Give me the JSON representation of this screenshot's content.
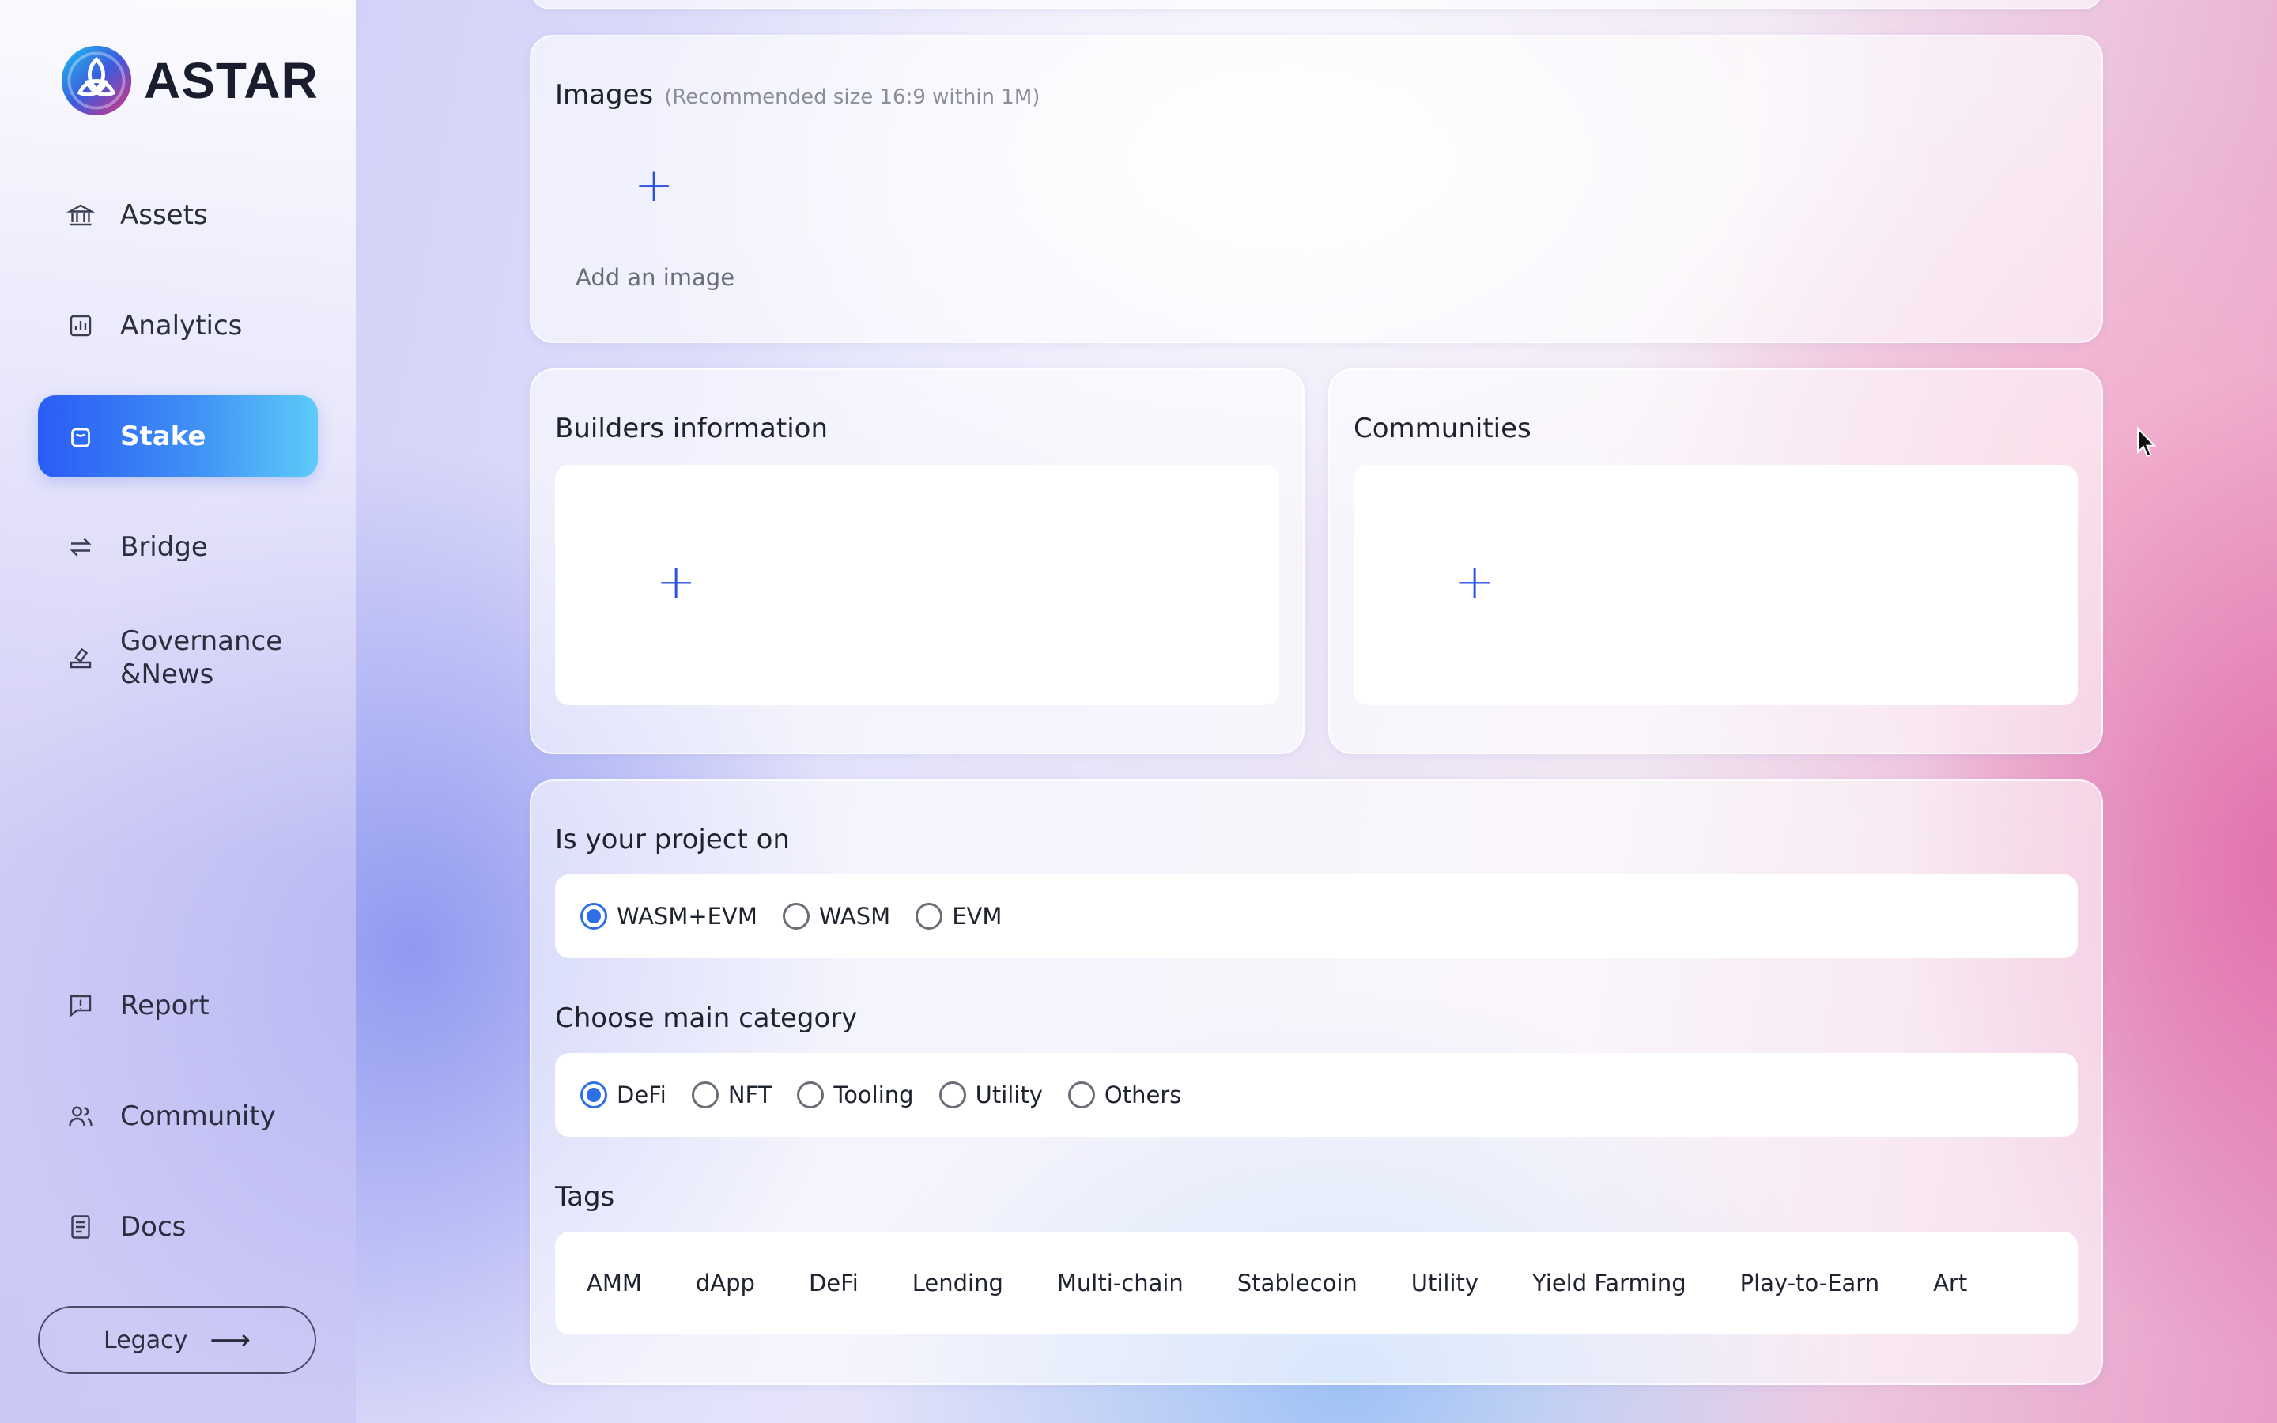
{
  "brand": {
    "name": "ASTAR"
  },
  "sidebar": {
    "items": [
      {
        "label": "Assets",
        "icon": "bank-icon"
      },
      {
        "label": "Analytics",
        "icon": "chart-icon"
      },
      {
        "label": "Stake",
        "icon": "bag-icon",
        "active": true
      },
      {
        "label": "Bridge",
        "icon": "swap-icon"
      },
      {
        "label": "Governance &News",
        "icon": "vote-icon"
      },
      {
        "label": "Report",
        "icon": "report-icon"
      },
      {
        "label": "Community",
        "icon": "people-icon"
      },
      {
        "label": "Docs",
        "icon": "document-icon"
      }
    ],
    "legacy_label": "Legacy"
  },
  "images": {
    "title": "Images",
    "hint": "(Recommended size 16:9 within 1M)",
    "add_label": "Add an image"
  },
  "builders": {
    "title": "Builders information"
  },
  "communities": {
    "title": "Communities"
  },
  "project_on": {
    "title": "Is your project on",
    "options": [
      "WASM+EVM",
      "WASM",
      "EVM"
    ],
    "selected": "WASM+EVM"
  },
  "main_category": {
    "title": "Choose main category",
    "options": [
      "DeFi",
      "NFT",
      "Tooling",
      "Utility",
      "Others"
    ],
    "selected": "DeFi"
  },
  "tags": {
    "title": "Tags",
    "items": [
      "AMM",
      "dApp",
      "DeFi",
      "Lending",
      "Multi-chain",
      "Stablecoin",
      "Utility",
      "Yield Farming",
      "Play-to-Earn",
      "Art"
    ]
  },
  "colors": {
    "accent": "#2b50e4",
    "active_start": "#2a5bf5",
    "active_end": "#5dcbf8",
    "radio": "#2f6fe6"
  }
}
